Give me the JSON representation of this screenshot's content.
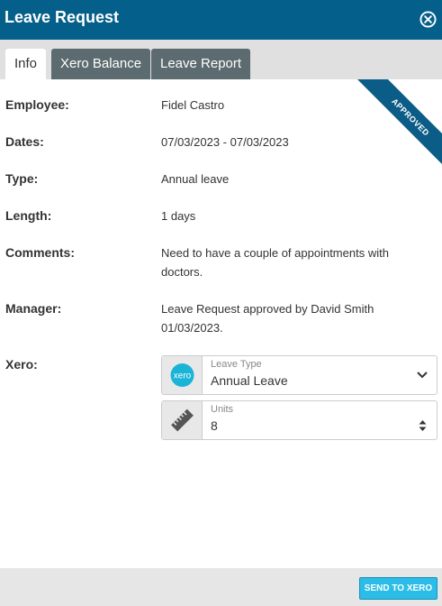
{
  "header": {
    "title": "Leave Request",
    "close_icon": "close-circle-icon"
  },
  "tabs": [
    {
      "label": "Info",
      "active": true
    },
    {
      "label": "Xero Balance",
      "active": false
    },
    {
      "label": "Leave Report",
      "active": false
    }
  ],
  "badge": {
    "text": "APPROVED",
    "color": "#0b5c86"
  },
  "details": {
    "employee_label": "Employee:",
    "employee": "Fidel Castro",
    "dates_label": "Dates:",
    "dates": "07/03/2023 - 07/03/2023",
    "type_label": "Type:",
    "type": "Annual leave",
    "length_label": "Length:",
    "length": "1 days",
    "comments_label": "Comments:",
    "comments": "Need to have a couple of appointments with doctors.",
    "manager_label": "Manager:",
    "manager": "Leave Request approved by David Smith 01/03/2023.",
    "xero_label": "Xero:"
  },
  "xero": {
    "logo_text": "xero",
    "leave_type_label": "Leave Type",
    "leave_type_value": "Annual Leave",
    "units_label": "Units",
    "units_value": "8"
  },
  "footer": {
    "send_label": "SEND TO XERO"
  },
  "colors": {
    "header": "#045f8a",
    "accent": "#2bbde8",
    "tab_inactive": "#5c6b6f"
  }
}
